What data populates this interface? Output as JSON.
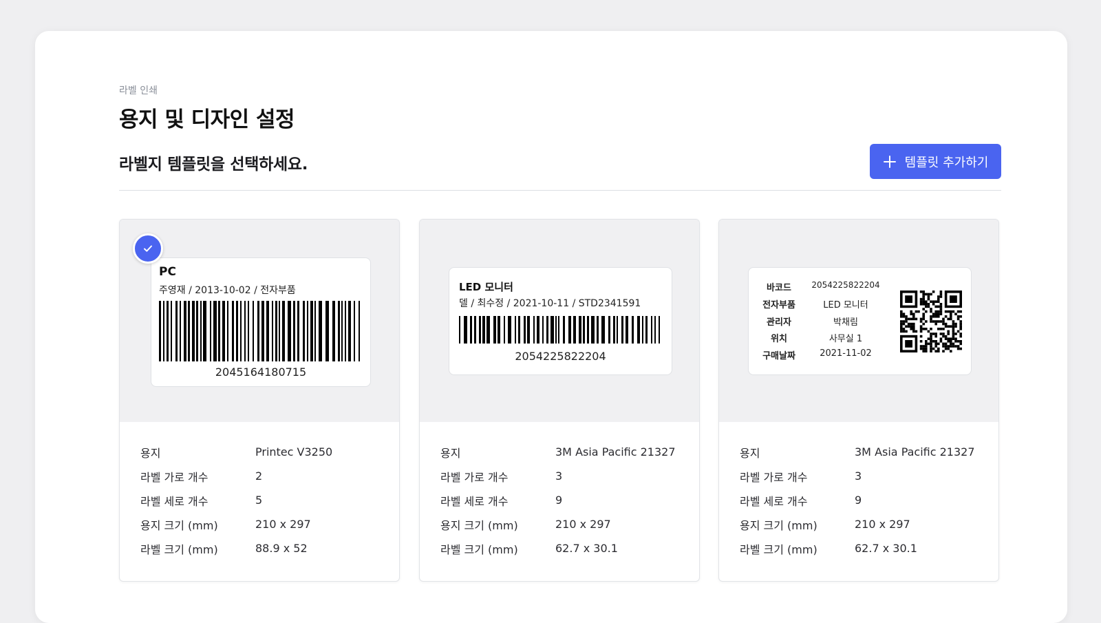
{
  "header": {
    "breadcrumb": "라벨 인쇄",
    "title": "용지 및 디자인 설정",
    "subtitle": "라벨지 템플릿을 선택하세요.",
    "add_button_label": "템플릿 추가하기"
  },
  "info_keys": [
    "용지",
    "라벨 가로 개수",
    "라벨 세로 개수",
    "용지 크기 (mm)",
    "라벨 크기 (mm)"
  ],
  "templates": [
    {
      "selected": true,
      "label_title": "PC",
      "label_sub": "주영재 / 2013-10-02 / 전자부품",
      "barcode_number": "2045164180715",
      "info": [
        "Printec V3250",
        "2",
        "5",
        "210 x 297",
        "88.9 x 52"
      ]
    },
    {
      "selected": false,
      "label_title": "LED 모니터",
      "label_sub": "델 / 최수정 / 2021-10-11 / STD2341591",
      "barcode_number": "2054225822204",
      "info": [
        "3M Asia Pacific 21327",
        "3",
        "9",
        "210 x 297",
        "62.7 x 30.1"
      ]
    },
    {
      "selected": false,
      "qr_fields": [
        {
          "key": "바코드",
          "value": "2054225822204"
        },
        {
          "key": "전자부품",
          "value": "LED 모니터"
        },
        {
          "key": "관리자",
          "value": "박채림"
        },
        {
          "key": "위치",
          "value": "사무실 1"
        },
        {
          "key": "구매날짜",
          "value": "2021-11-02"
        }
      ],
      "info": [
        "3M Asia Pacific 21327",
        "3",
        "9",
        "210 x 297",
        "62.7 x 30.1"
      ]
    }
  ],
  "colors": {
    "accent": "#4a64f0"
  },
  "icons": {
    "add": "plus-icon",
    "selected": "check-icon",
    "qr": "qr-code-icon"
  }
}
